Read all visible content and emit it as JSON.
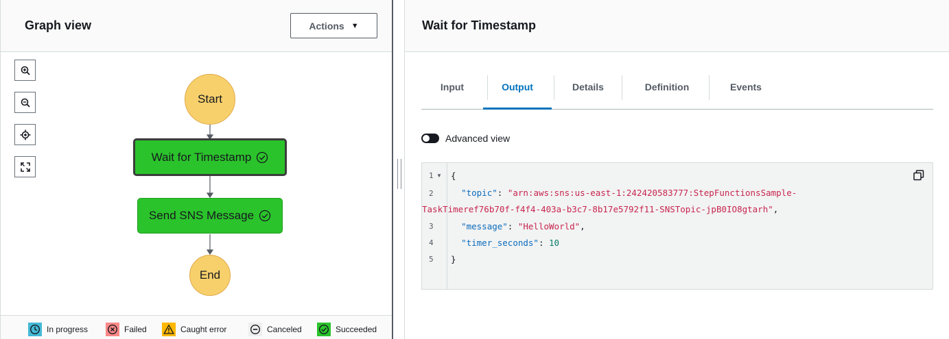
{
  "graph_panel": {
    "title": "Graph view",
    "actions_label": "Actions",
    "zoom_controls": [
      "zoom-in-icon",
      "zoom-out-icon",
      "center-icon",
      "fit-screen-icon"
    ],
    "nodes": [
      {
        "label": "Start",
        "kind": "terminal"
      },
      {
        "label": "Wait for Timestamp",
        "kind": "state",
        "status": "Succeeded",
        "selected": true
      },
      {
        "label": "Send SNS Message",
        "kind": "state",
        "status": "Succeeded",
        "selected": false
      },
      {
        "label": "End",
        "kind": "terminal"
      }
    ],
    "legend": [
      {
        "label": "In progress",
        "icon": "clock-icon",
        "color": "#44b9d6"
      },
      {
        "label": "Failed",
        "icon": "x-circle-icon",
        "color": "#ff8888"
      },
      {
        "label": "Caught error",
        "icon": "warning-icon",
        "color": "#ffb700"
      },
      {
        "label": "Canceled",
        "icon": "minus-circle-icon",
        "color": "#cccccc"
      },
      {
        "label": "Succeeded",
        "icon": "check-circle-icon",
        "color": "#2bc32b"
      }
    ]
  },
  "detail_panel": {
    "title": "Wait for Timestamp",
    "tabs": [
      "Input",
      "Output",
      "Details",
      "Definition",
      "Events"
    ],
    "active_tab": "Output",
    "advanced_view_label": "Advanced view",
    "code": {
      "line_numbers": [
        "1",
        "2",
        "3",
        "4",
        "5"
      ],
      "open_brace": "{",
      "close_brace": "}",
      "topic_key": "\"topic\"",
      "topic_value_1": "\"arn:aws:sns:us-east-1:242420583777:StepFunctionsSample-",
      "topic_value_2": "TaskTimeref76b70f-f4f4-403a-b3c7-8b17e5792f11-SNSTopic-jpB0IO8gtarh\"",
      "message_key": "\"message\"",
      "message_value": "\"HelloWorld\"",
      "timer_key": "\"timer_seconds\"",
      "timer_value": "10"
    }
  },
  "colors": {
    "succeeded": "#2bc32b",
    "terminal": "#f7d06b",
    "accent": "#0073bb"
  }
}
